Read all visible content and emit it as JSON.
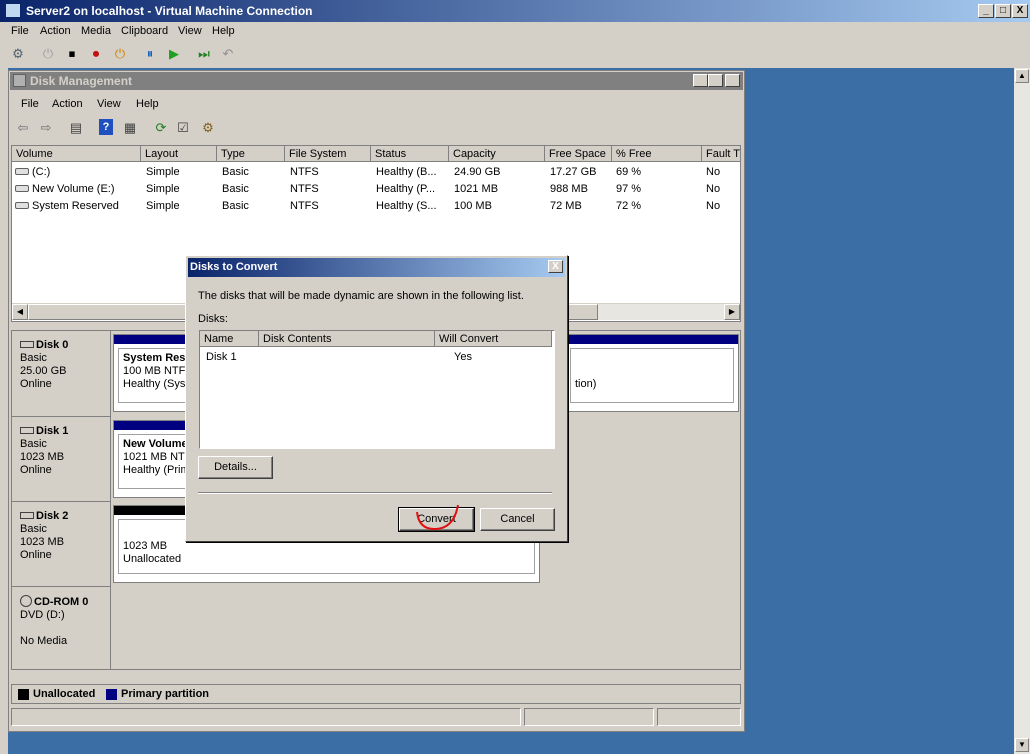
{
  "vmc": {
    "title": "Server2 on localhost - Virtual Machine Connection",
    "menu": [
      "File",
      "Action",
      "Media",
      "Clipboard",
      "View",
      "Help"
    ],
    "window_buttons": [
      "_",
      "□",
      "X"
    ]
  },
  "dm": {
    "title": "Disk Management",
    "menu": [
      "File",
      "Action",
      "View",
      "Help"
    ],
    "columns": [
      "Volume",
      "Layout",
      "Type",
      "File System",
      "Status",
      "Capacity",
      "Free Space",
      "% Free",
      "Fault T"
    ],
    "rows": [
      [
        "(C:)",
        "Simple",
        "Basic",
        "NTFS",
        "Healthy (B...",
        "24.90 GB",
        "17.27 GB",
        "69 %",
        "No"
      ],
      [
        "New Volume (E:)",
        "Simple",
        "Basic",
        "NTFS",
        "Healthy (P...",
        "1021 MB",
        "988 MB",
        "97 %",
        "No"
      ],
      [
        "System Reserved",
        "Simple",
        "Basic",
        "NTFS",
        "Healthy (S...",
        "100 MB",
        "72 MB",
        "72 %",
        "No"
      ]
    ],
    "disks": [
      {
        "name": "Disk 0",
        "type": "Basic",
        "size": "25.00 GB",
        "state": "Online",
        "part_name": "System Res",
        "part_size": "100 MB NTFS",
        "part_status": "Healthy (Syst",
        "right_text": "tion)"
      },
      {
        "name": "Disk 1",
        "type": "Basic",
        "size": "1023 MB",
        "state": "Online",
        "part_name": "New Volume",
        "part_size": "1021 MB NTF",
        "part_status": "Healthy (Prim"
      },
      {
        "name": "Disk 2",
        "type": "Basic",
        "size": "1023 MB",
        "state": "Online",
        "part_size": "1023 MB",
        "part_status": "Unallocated"
      },
      {
        "name": "CD-ROM 0",
        "type": "DVD (D:)",
        "state": "No Media"
      }
    ],
    "legend": {
      "unallocated": "Unallocated",
      "primary": "Primary partition",
      "unallocated_color": "#000000",
      "primary_color": "#000080"
    }
  },
  "dialog": {
    "title": "Disks to Convert",
    "description": "The disks that will be made dynamic are shown in the following list.",
    "disks_label": "Disks:",
    "columns": [
      "Name",
      "Disk Contents",
      "Will Convert"
    ],
    "rows": [
      [
        "Disk 1",
        "",
        "Yes"
      ]
    ],
    "details": "Details...",
    "convert": "Convert",
    "cancel": "Cancel"
  }
}
